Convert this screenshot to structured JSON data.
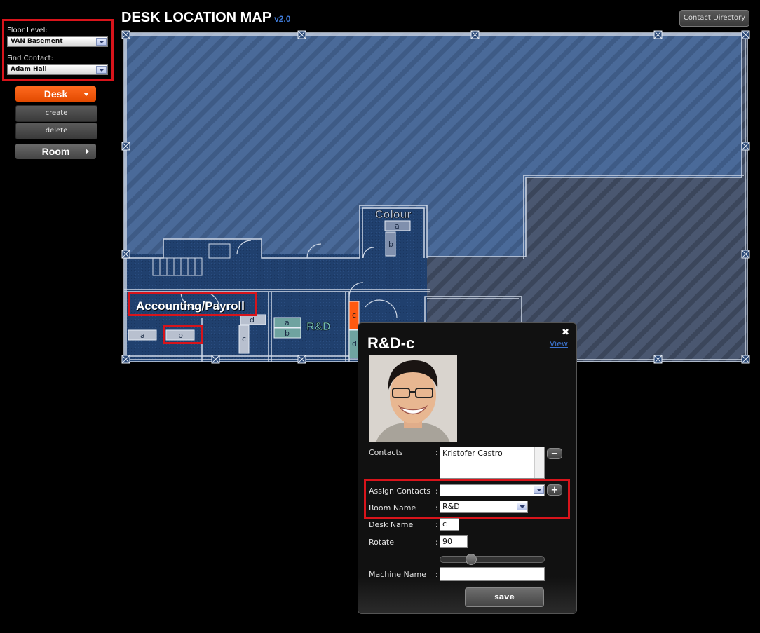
{
  "header": {
    "title": "DESK LOCATION MAP",
    "version": "v2.0",
    "contact_directory": "Contact Directory"
  },
  "sidebar": {
    "floor_level_label": "Floor Level:",
    "floor_level_value": "VAN Basement",
    "find_contact_label": "Find Contact:",
    "find_contact_value": "Adam Hall",
    "desk_menu": "Desk",
    "create": "create",
    "delete": "delete",
    "room_menu": "Room"
  },
  "map": {
    "rooms": {
      "accounting": "Accounting/Payroll",
      "colour": "Colour",
      "rnd": "R&D"
    },
    "desks": {
      "colour_a": "a",
      "colour_b": "b",
      "acc_a": "a",
      "acc_b": "b",
      "acc_c": "c",
      "acc_d": "d",
      "rnd_a": "a",
      "rnd_b": "b",
      "rnd_c": "c",
      "rnd_d": "d"
    }
  },
  "popup": {
    "title": "R&D-c",
    "close": "✖",
    "view": "View",
    "contacts_label": "Contacts",
    "contacts_value": "Kristofer Castro",
    "assign_label": "Assign Contacts",
    "assign_value": "",
    "room_label": "Room Name",
    "room_value": "R&D",
    "desk_label": "Desk Name",
    "desk_value": "c",
    "rotate_label": "Rotate",
    "rotate_value": "90",
    "machine_label": "Machine Name",
    "machine_value": "",
    "save": "save",
    "colon": ":",
    "slider_fraction": 0.27
  }
}
